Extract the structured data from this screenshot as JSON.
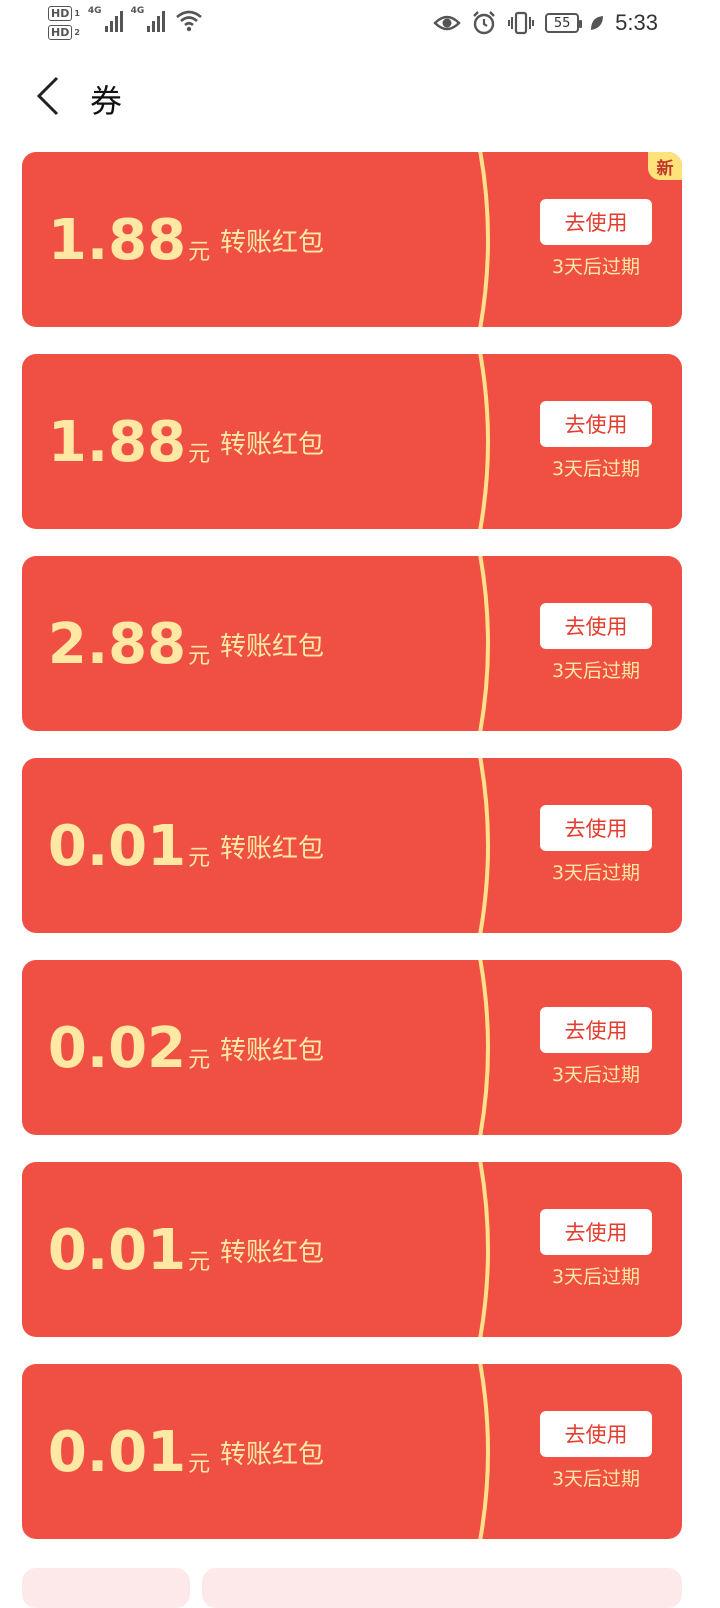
{
  "status_bar": {
    "hd1": "HD",
    "hd1_sub": "1",
    "hd2": "HD",
    "hd2_sub": "2",
    "sim1_tag": "4G",
    "sim2_tag": "4G",
    "battery": "55",
    "time": "5:33"
  },
  "header": {
    "title": "券"
  },
  "coupons": [
    {
      "amount": "1.88",
      "unit": "元",
      "name": "转账红包",
      "button": "去使用",
      "expire": "3天后过期",
      "badge": "新"
    },
    {
      "amount": "1.88",
      "unit": "元",
      "name": "转账红包",
      "button": "去使用",
      "expire": "3天后过期"
    },
    {
      "amount": "2.88",
      "unit": "元",
      "name": "转账红包",
      "button": "去使用",
      "expire": "3天后过期"
    },
    {
      "amount": "0.01",
      "unit": "元",
      "name": "转账红包",
      "button": "去使用",
      "expire": "3天后过期"
    },
    {
      "amount": "0.02",
      "unit": "元",
      "name": "转账红包",
      "button": "去使用",
      "expire": "3天后过期"
    },
    {
      "amount": "0.01",
      "unit": "元",
      "name": "转账红包",
      "button": "去使用",
      "expire": "3天后过期"
    },
    {
      "amount": "0.01",
      "unit": "元",
      "name": "转账红包",
      "button": "去使用",
      "expire": "3天后过期"
    }
  ],
  "colors": {
    "card_bg": "#ef5043",
    "accent_text": "#ffe8a3",
    "button_text": "#e43d30",
    "curve": "#ffe08a"
  }
}
